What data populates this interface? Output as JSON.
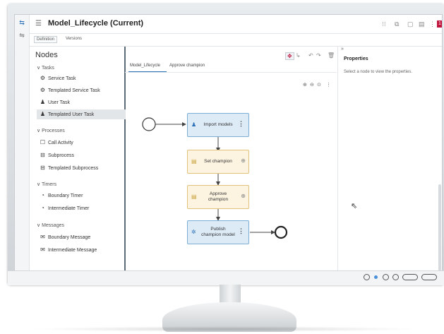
{
  "window": {
    "title": "Model_Lifecycle (Current)",
    "toolbar_icons": [
      "dots-icon",
      "copy-icon",
      "square-icon",
      "save-icon",
      "more-icon",
      "user-icon"
    ],
    "user_badge": "1"
  },
  "subtabs": [
    {
      "label": "Definition",
      "active": true
    },
    {
      "label": "Versions",
      "active": false
    }
  ],
  "nodes_panel": {
    "title": "Nodes",
    "groups": [
      {
        "label": "Tasks",
        "items": [
          {
            "label": "Service Task",
            "icon": "gears-icon"
          },
          {
            "label": "Templated Service Task",
            "icon": "gears-icon"
          },
          {
            "label": "User Task",
            "icon": "user-icon"
          },
          {
            "label": "Templated User Task",
            "icon": "user-icon",
            "selected": true
          }
        ]
      },
      {
        "label": "Processes",
        "items": [
          {
            "label": "Call Activity",
            "icon": "box-icon"
          },
          {
            "label": "Subprocess",
            "icon": "subprocess-icon"
          },
          {
            "label": "Templated Subprocess",
            "icon": "subprocess-icon"
          }
        ]
      },
      {
        "label": "Timers",
        "items": [
          {
            "label": "Boundary Timer",
            "icon": "clock-icon"
          },
          {
            "label": "Intermediate Timer",
            "icon": "clock-icon"
          }
        ]
      },
      {
        "label": "Messages",
        "items": [
          {
            "label": "Boundary Message",
            "icon": "envelope-icon"
          },
          {
            "label": "Intermediate Message",
            "icon": "envelope-icon"
          }
        ]
      }
    ]
  },
  "canvas": {
    "tabs": [
      "Model_Lifecycle",
      "Approve champion"
    ],
    "nodes": [
      {
        "label": "Import models",
        "type": "user-task"
      },
      {
        "label": "Set champion",
        "type": "script-task"
      },
      {
        "label": "Approve\nchampion",
        "type": "script-task"
      },
      {
        "label": "Publish\nchampion model",
        "type": "service-task"
      }
    ]
  },
  "properties": {
    "title": "Properties",
    "message": "Select a node to view the properties.",
    "collapse": "»"
  },
  "colors": {
    "accent": "#2b6fb7",
    "user_task": "#ddebf7",
    "script_task": "#fcf4e0",
    "badge": "#c0143c"
  }
}
